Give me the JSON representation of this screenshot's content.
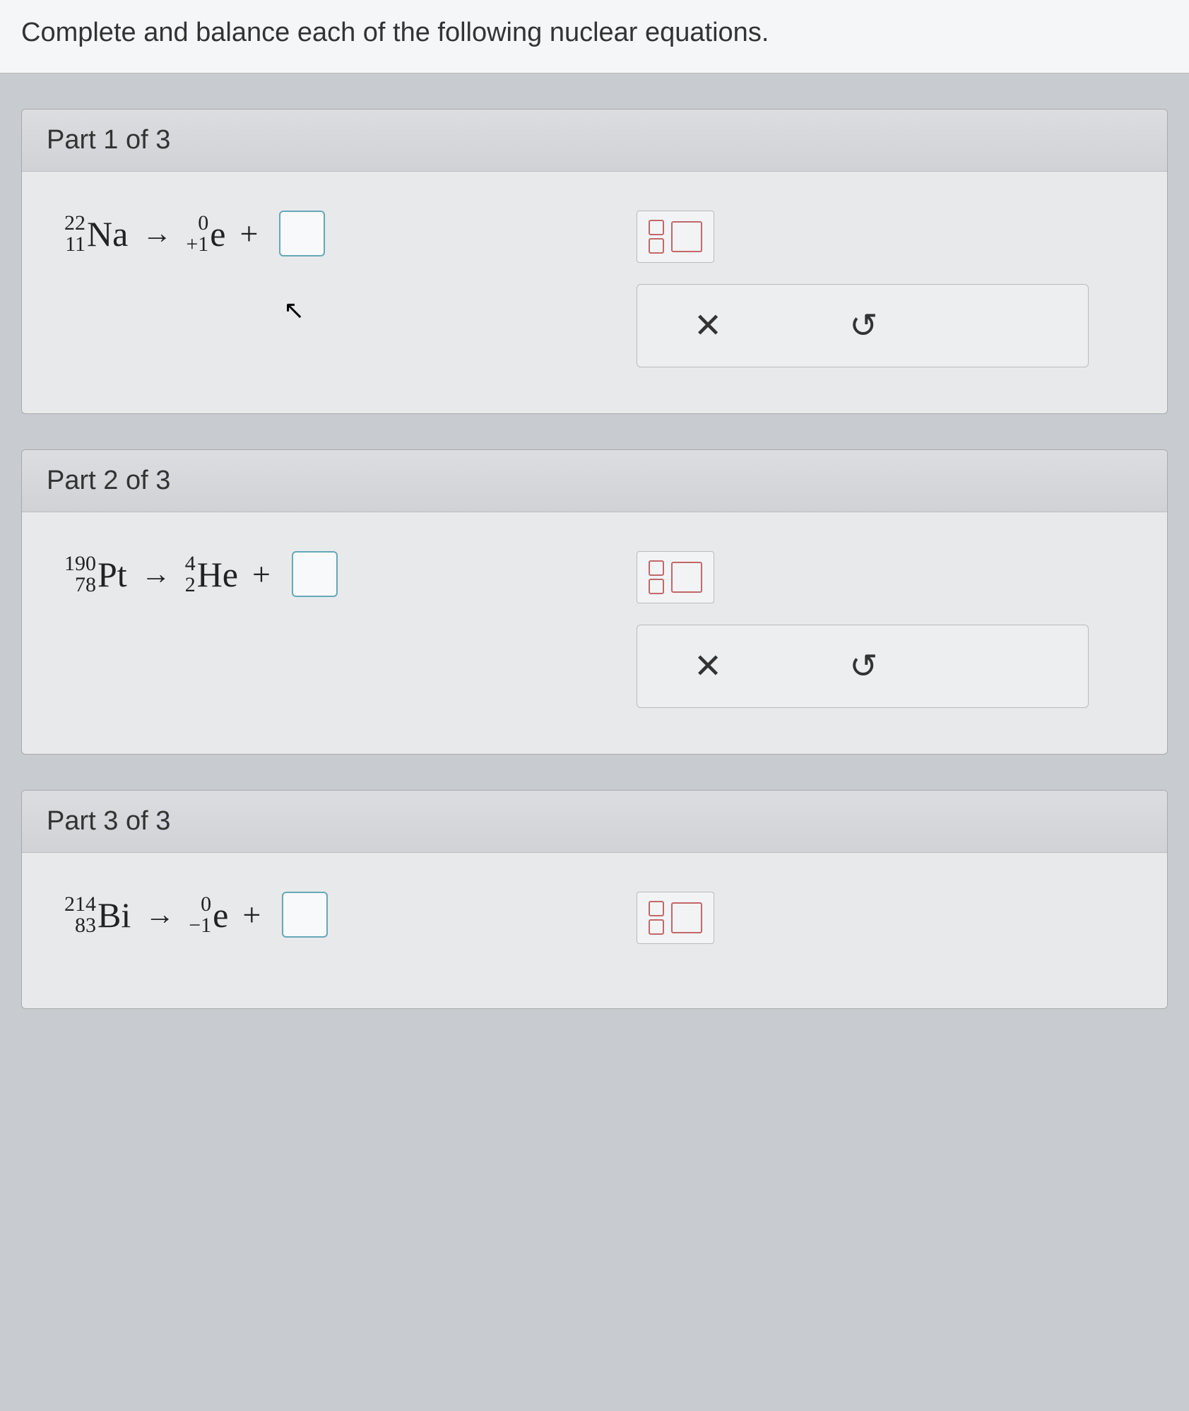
{
  "header": "Complete and balance each of the following nuclear equations.",
  "parts": [
    {
      "title": "Part 1 of 3",
      "reactant": {
        "mass": "22",
        "atomic": "11",
        "symbol": "Na"
      },
      "product1": {
        "mass": "0",
        "atomic": "+1",
        "symbol": "e"
      },
      "has_cursor": true
    },
    {
      "title": "Part 2 of 3",
      "reactant": {
        "mass": "190",
        "atomic": "78",
        "symbol": "Pt"
      },
      "product1": {
        "mass": "4",
        "atomic": "2",
        "symbol": "He"
      },
      "has_cursor": false
    },
    {
      "title": "Part 3 of 3",
      "reactant": {
        "mass": "214",
        "atomic": "83",
        "symbol": "Bi"
      },
      "product1": {
        "mass": "0",
        "atomic": "−1",
        "symbol": "e"
      },
      "has_cursor": false
    }
  ],
  "icons": {
    "clear": "✕",
    "reset": "↺"
  }
}
